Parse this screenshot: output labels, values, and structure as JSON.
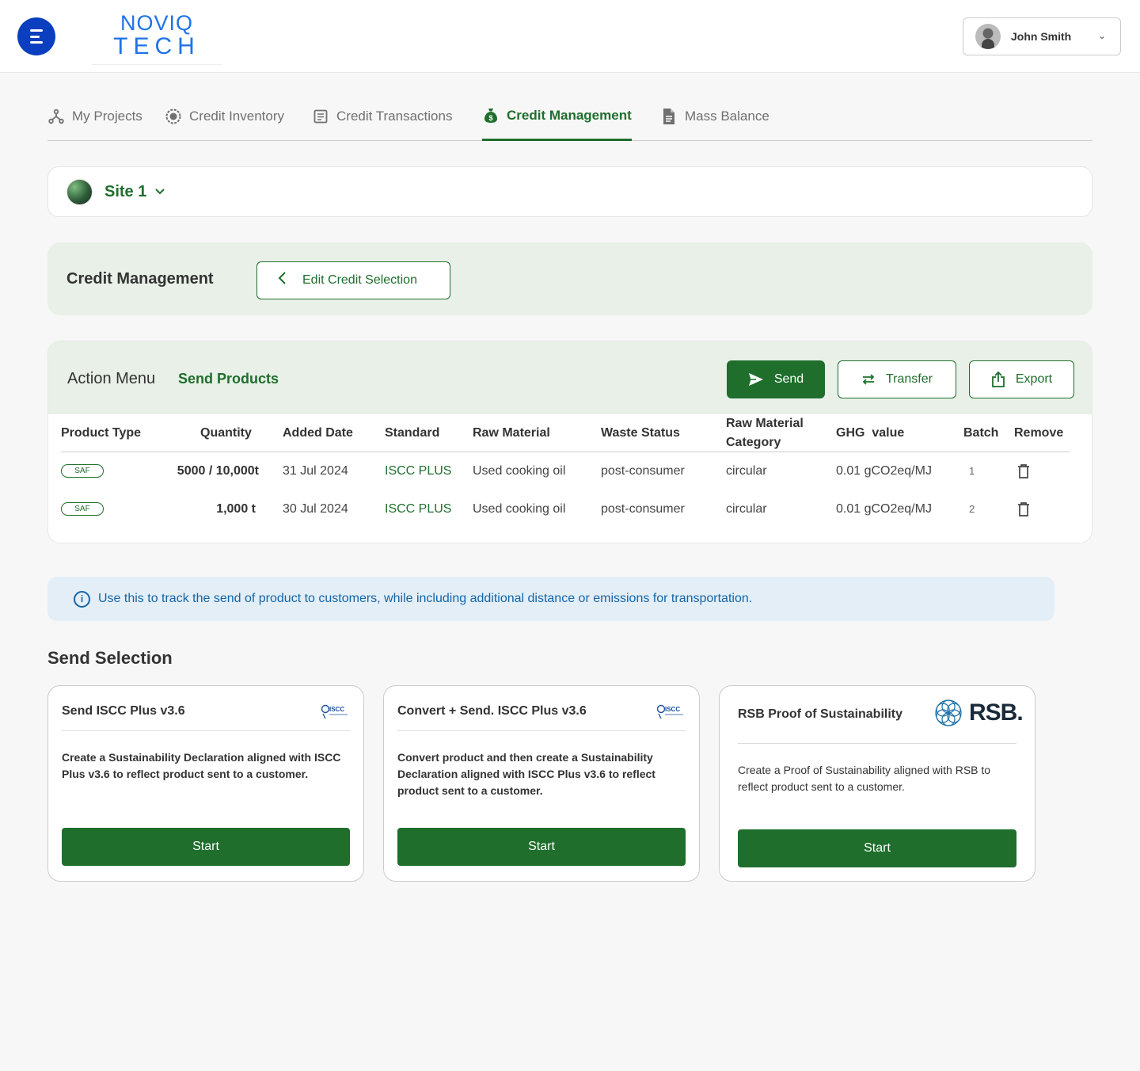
{
  "header": {
    "logo_line1": "NOVIQ",
    "logo_line2": "TECH",
    "user_name": "John Smith"
  },
  "tabs": [
    {
      "label": "My Projects",
      "icon": "network-icon"
    },
    {
      "label": "Credit Inventory",
      "icon": "badge-icon"
    },
    {
      "label": "Credit Transactions",
      "icon": "document-icon"
    },
    {
      "label": "Credit Management",
      "icon": "money-bag-icon",
      "active": true
    },
    {
      "label": "Mass Balance",
      "icon": "file-icon"
    }
  ],
  "site": {
    "name": "Site 1"
  },
  "credit_management": {
    "title": "Credit Management",
    "edit_label": "Edit Credit Selection"
  },
  "action_menu": {
    "title": "Action Menu",
    "subtitle": "Send Products",
    "send_label": "Send",
    "transfer_label": "Transfer",
    "export_label": "Export"
  },
  "table": {
    "headers": {
      "product_type": "Product Type",
      "quantity": "Quantity",
      "added_date": "Added Date",
      "standard": "Standard",
      "raw_material": "Raw Material",
      "waste_status": "Waste Status",
      "raw_material_category_1": "Raw Material",
      "raw_material_category_2": "Category",
      "ghg_value": "GHG  value",
      "batch": "Batch",
      "remove": "Remove"
    },
    "rows": [
      {
        "product_type": "SAF",
        "quantity": "5000 / 10,000t",
        "added_date": "31 Jul 2024",
        "standard": "ISCC PLUS",
        "raw_material": "Used cooking oil",
        "waste_status": "post-consumer",
        "category": "circular",
        "ghg": "0.01 gCO2eq/MJ",
        "batch": "1"
      },
      {
        "product_type": "SAF",
        "quantity": "1,000 t",
        "added_date": "30 Jul 2024",
        "standard": "ISCC PLUS",
        "raw_material": "Used cooking oil",
        "waste_status": "post-consumer",
        "category": "circular",
        "ghg": "0.01 gCO2eq/MJ",
        "batch": "2"
      }
    ]
  },
  "info": {
    "text": "Use this to track the send of product to customers, while including additional distance or emissions for transportation."
  },
  "send_selection": {
    "title": "Send Selection",
    "cards": [
      {
        "title": "Send ISCC Plus v3.6",
        "description": "Create a Sustainability Declaration aligned with ISCC Plus v3.6 to reflect product sent to a customer.",
        "button": "Start",
        "logo": "ISCC"
      },
      {
        "title": "Convert + Send. ISCC Plus v3.6",
        "description": "Convert product and  then create a Sustainability Declaration aligned with ISCC Plus v3.6 to reflect product sent to a customer.",
        "button": "Start",
        "logo": "ISCC"
      },
      {
        "title": "RSB Proof of Sustainability",
        "description": "Create a Proof of Sustainability aligned with RSB to reflect product sent to a customer.",
        "button": "Start",
        "logo": "RSB."
      }
    ]
  },
  "colors": {
    "primary_green": "#1f6e2c",
    "light_green": "#e8f0e8",
    "brand_blue": "#0b3fbf",
    "info_blue": "#1565a8"
  }
}
